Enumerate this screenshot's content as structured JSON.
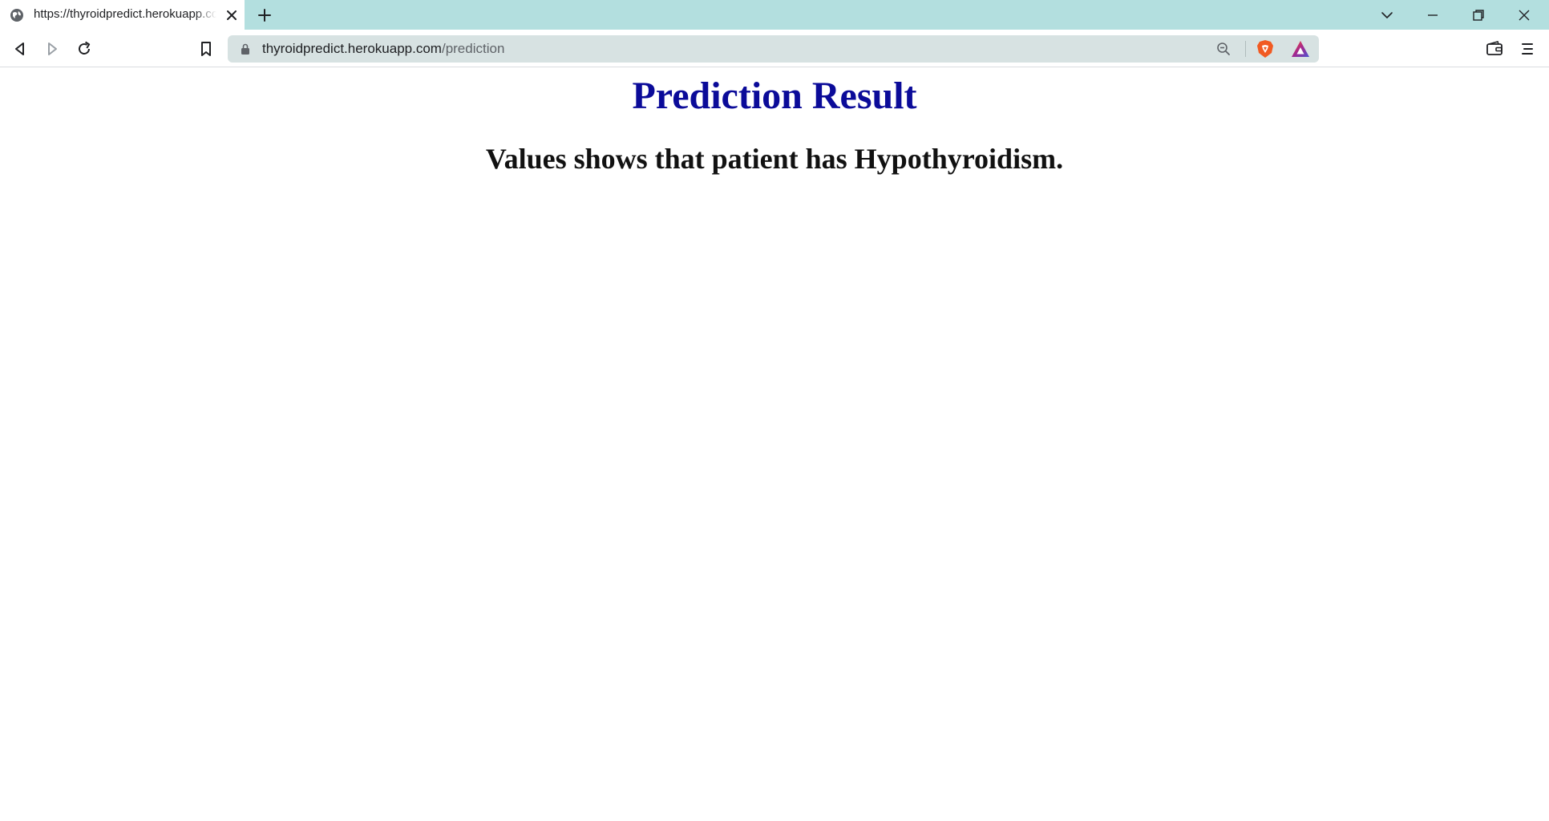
{
  "browser": {
    "tab": {
      "title": "https://thyroidpredict.herokuapp.com/prediction",
      "favicon": "globe-icon"
    },
    "address_bar": {
      "host": "thyroidpredict.herokuapp.com",
      "path": "/prediction"
    },
    "colors": {
      "tabstrip_bg": "#b3dfdf",
      "omnibox_bg": "#d7e2e2"
    }
  },
  "page": {
    "title": "Prediction Result",
    "result": "Values shows that patient has Hypothyroidism.",
    "colors": {
      "title": "#0b0b99",
      "result": "#111111"
    }
  }
}
